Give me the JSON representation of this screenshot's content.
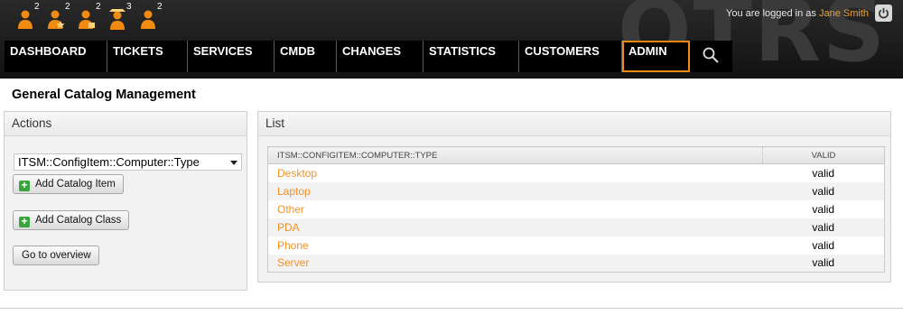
{
  "toolbar": {
    "icons": [
      {
        "name": "user-icon",
        "count": "2"
      },
      {
        "name": "user-star-icon",
        "count": "2"
      },
      {
        "name": "user-lock-icon",
        "count": "2"
      },
      {
        "name": "user-alert-icon",
        "count": "3"
      },
      {
        "name": "user-icon",
        "count": "2"
      }
    ]
  },
  "brand": "OTRS",
  "login": {
    "prefix": "You are logged in as",
    "user": "Jane Smith"
  },
  "nav": {
    "items": [
      "DASHBOARD",
      "TICKETS",
      "SERVICES",
      "CMDB",
      "CHANGES",
      "STATISTICS",
      "CUSTOMERS",
      "ADMIN"
    ],
    "active": "ADMIN"
  },
  "page": {
    "title": "General Catalog Management"
  },
  "actions": {
    "title": "Actions",
    "select_value": "ITSM::ConfigItem::Computer::Type",
    "add_item": "Add Catalog Item",
    "add_class": "Add Catalog Class",
    "overview": "Go to overview"
  },
  "list": {
    "title": "List",
    "columns": [
      "ITSM::CONFIGITEM::COMPUTER::TYPE",
      "VALID"
    ],
    "rows": [
      {
        "name": "Desktop",
        "valid": "valid"
      },
      {
        "name": "Laptop",
        "valid": "valid"
      },
      {
        "name": "Other",
        "valid": "valid"
      },
      {
        "name": "PDA",
        "valid": "valid"
      },
      {
        "name": "Phone",
        "valid": "valid"
      },
      {
        "name": "Server",
        "valid": "valid"
      }
    ]
  },
  "colors": {
    "accent": "#f08a10",
    "link": "#f0922a",
    "header_bg": "#1e1e1e"
  }
}
